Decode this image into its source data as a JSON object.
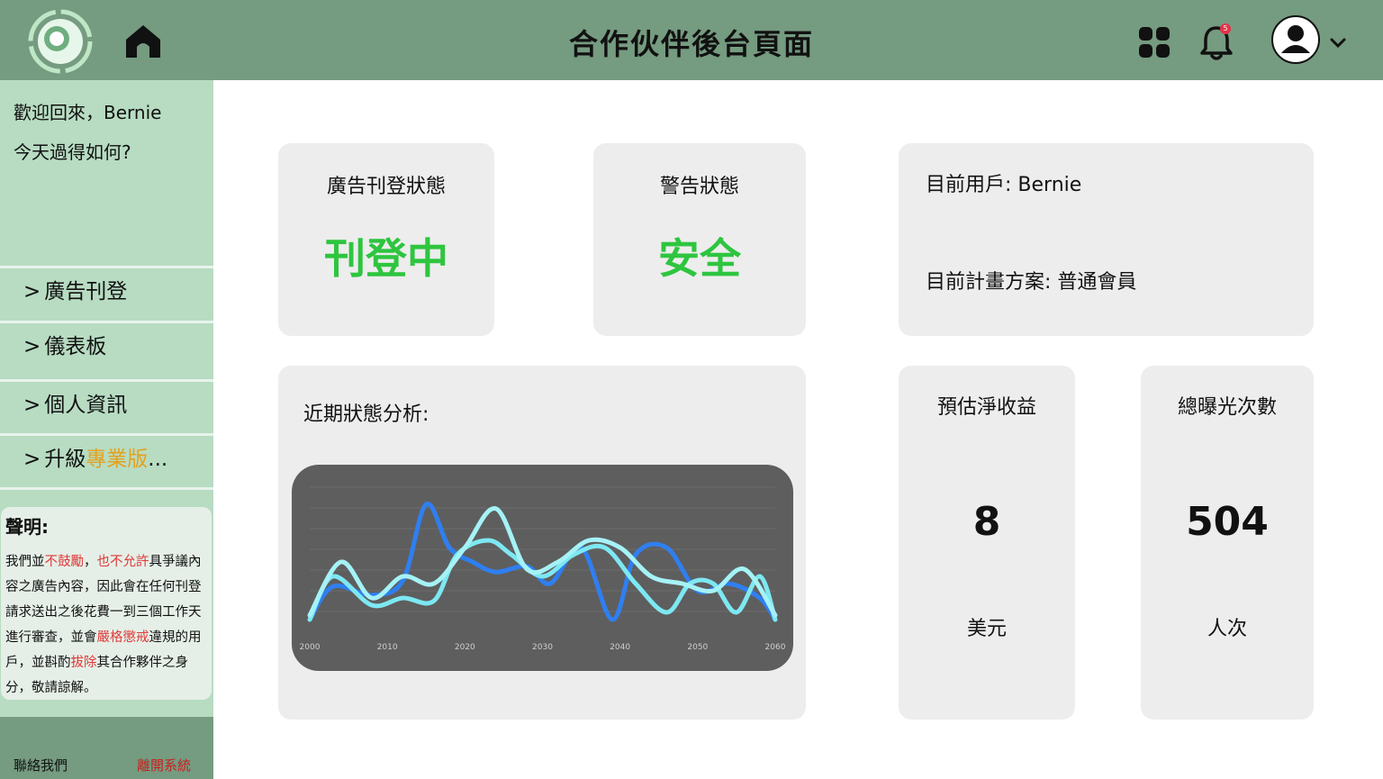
{
  "header": {
    "title": "合作伙伴後台頁面",
    "notification_count": "5"
  },
  "sidebar": {
    "welcome_line": "歡迎回來，Bernie",
    "greeting": "今天過得如何?",
    "nav": [
      {
        "label": "廣告刊登"
      },
      {
        "label": "儀表板"
      },
      {
        "label": "個人資訊"
      },
      {
        "label": "升級",
        "accent": "專業版",
        "suffix": "..."
      }
    ],
    "notice": {
      "title": "聲明:",
      "p1": "我們並",
      "r1": "不鼓勵",
      "p2": "，",
      "r2": "也不允許",
      "p3": "具爭議內容之廣告內容，因此會在任何刊登請求送出之後花費一到三個工作天進行審查，並會",
      "r3": "嚴格懲戒",
      "p4": "違規的用戶，並斟酌",
      "r4": "拔除",
      "p5": "其合作夥伴之身分，敬請諒解。"
    },
    "footer": {
      "contact": "聯絡我們",
      "logout": "離開系統"
    }
  },
  "cards": {
    "ad_status": {
      "label": "廣告刊登狀態",
      "value": "刊登中"
    },
    "warning": {
      "label": "警告狀態",
      "value": "安全"
    },
    "user": {
      "user_label": "目前用戶:",
      "user_value": "Bernie",
      "plan_label": "目前計畫方案:",
      "plan_value": "普通會員"
    },
    "analysis": {
      "label": "近期狀態分析:"
    },
    "revenue": {
      "label": "預估淨收益",
      "value": "8",
      "unit": "美元"
    },
    "exposure": {
      "label": "總曝光次數",
      "value": "504",
      "unit": "人次"
    }
  },
  "colors": {
    "header_bg": "#759b80",
    "sidebar_bg": "#b7dcc2",
    "status_green": "#2ec53f",
    "accent_orange": "#e3a21f",
    "warn_red": "#e03a3a"
  },
  "chart_data": {
    "type": "line",
    "x_ticks": [
      "2000",
      "2010",
      "2020",
      "2030",
      "2040",
      "2050",
      "2060"
    ],
    "series": [
      {
        "color": "#2f7ff0",
        "x": [
          2000,
          2003,
          2008,
          2012,
          2015,
          2018,
          2021,
          2024,
          2028,
          2031,
          2035,
          2039,
          2042,
          2046,
          2050,
          2054,
          2058,
          2060
        ],
        "y": [
          0.05,
          0.28,
          0.22,
          0.32,
          0.85,
          0.55,
          0.45,
          0.38,
          0.42,
          0.3,
          0.55,
          0.05,
          0.5,
          0.55,
          0.25,
          0.3,
          0.2,
          0.05
        ]
      },
      {
        "color": "#7de8f2",
        "x": [
          2000,
          2003,
          2008,
          2012,
          2016,
          2019,
          2023,
          2026,
          2030,
          2034,
          2038,
          2042,
          2046,
          2049,
          2052,
          2055,
          2058,
          2060
        ],
        "y": [
          0.05,
          0.35,
          0.15,
          0.2,
          0.18,
          0.5,
          0.6,
          0.5,
          0.35,
          0.5,
          0.55,
          0.3,
          0.1,
          0.3,
          0.3,
          0.1,
          0.35,
          0.05
        ]
      },
      {
        "color": "#a5f2f6",
        "x": [
          2000,
          2004,
          2008,
          2012,
          2016,
          2020,
          2024,
          2028,
          2032,
          2036,
          2040,
          2044,
          2048,
          2052,
          2056,
          2060
        ],
        "y": [
          0.08,
          0.45,
          0.2,
          0.35,
          0.3,
          0.55,
          0.82,
          0.4,
          0.45,
          0.6,
          0.55,
          0.35,
          0.3,
          0.25,
          0.4,
          0.08
        ]
      }
    ]
  }
}
